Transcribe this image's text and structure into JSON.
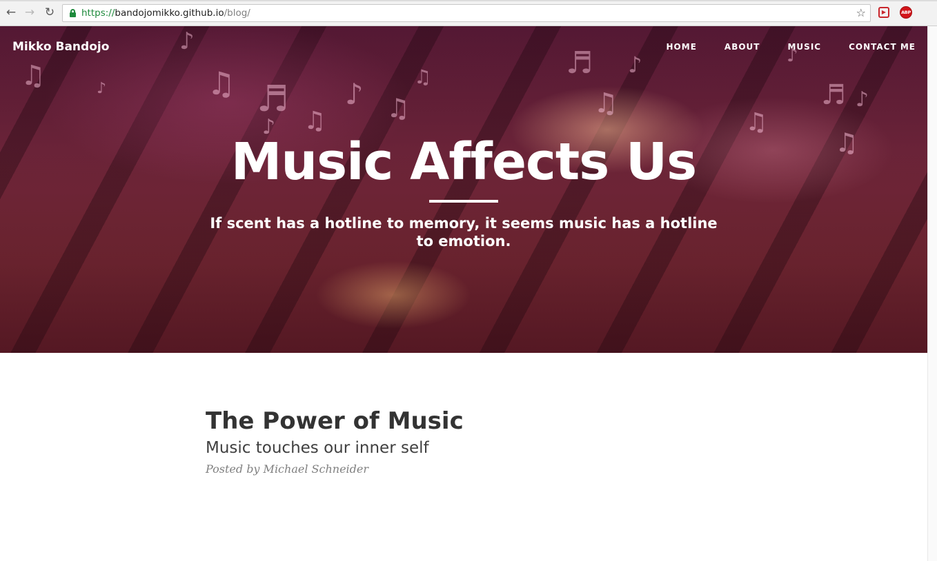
{
  "browser": {
    "url_scheme": "https://",
    "url_host": "bandojomikko.github.io",
    "url_path": "/blog/",
    "back_icon": "arrow-left",
    "forward_icon": "arrow-right",
    "reload_icon": "reload",
    "bookmark_icon": "star",
    "extension_1_icon": "media-forward",
    "extension_2_label": "ABP"
  },
  "site": {
    "brand": "Mikko Bandojo",
    "nav": [
      {
        "label": "HOME"
      },
      {
        "label": "ABOUT"
      },
      {
        "label": "MUSIC"
      },
      {
        "label": "CONTACT ME"
      }
    ]
  },
  "hero": {
    "title": "Music Affects Us",
    "subtitle": "If scent has a hotline to memory, it seems music has a hotline to emotion."
  },
  "post": {
    "title": "The Power of Music",
    "subtitle": "Music touches our inner self",
    "meta": "Posted by Michael Schneider"
  },
  "colors": {
    "hero_base": "#6c2439",
    "text_dark": "#333333",
    "meta_gray": "#808080",
    "secure_green": "#1e8a3c"
  }
}
